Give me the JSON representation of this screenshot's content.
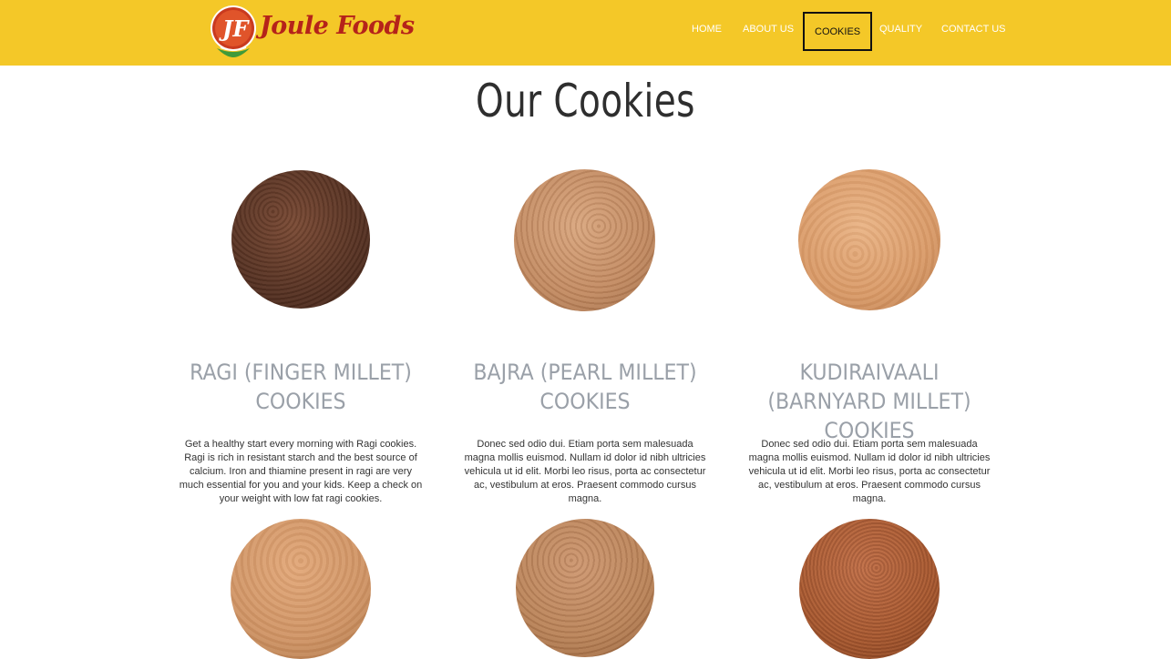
{
  "brand": {
    "logo_text": "Joule Foods",
    "logo_mark_text": "JF",
    "colors": {
      "header_bg": "#f4c828",
      "logo_red": "#b5231a",
      "logo_green": "#3f9a3a"
    }
  },
  "nav": {
    "items": [
      {
        "label": "HOME",
        "active": false
      },
      {
        "label": "ABOUT US",
        "active": false
      },
      {
        "label": "COOKIES",
        "active": true
      },
      {
        "label": "QUALITY",
        "active": false
      },
      {
        "label": "CONTACT US",
        "active": false
      }
    ]
  },
  "page": {
    "title": "Our Cookies"
  },
  "products": [
    {
      "title": "RAGI (FINGER MILLET) COOKIES",
      "description": "Get a healthy start every morning with Ragi cookies. Ragi is rich in resistant starch and the best source of calcium. Iron and thiamine present in ragi are very much essential for you and your kids. Keep a check on your weight with low fat ragi cookies.",
      "image": "ragi-cookie-image",
      "color": "#5a3424"
    },
    {
      "title": "BAJRA (PEARL MILLET) COOKIES",
      "description": "Donec sed odio dui. Etiam porta sem malesuada magna mollis euismod. Nullam id dolor id nibh ultricies vehicula ut id elit. Morbi leo risus, porta ac consectetur ac, vestibulum at eros. Praesent commodo cursus magna.",
      "image": "bajra-cookie-image",
      "color": "#c08860"
    },
    {
      "title": "KUDIRAIVAALI (BARNYARD MILLET) COOKIES",
      "description": "Donec sed odio dui. Etiam porta sem malesuada magna mollis euismod. Nullam id dolor id nibh ultricies vehicula ut id elit. Morbi leo risus, porta ac consectetur ac, vestibulum at eros. Praesent commodo cursus magna.",
      "image": "kudiraivaali-cookie-image",
      "color": "#d99a68"
    }
  ],
  "second_row_images": [
    {
      "image": "cookie-image",
      "color": "#cf9466"
    },
    {
      "image": "cookie-image",
      "color": "#b88258"
    },
    {
      "image": "cookie-image",
      "color": "#a85a32"
    }
  ]
}
